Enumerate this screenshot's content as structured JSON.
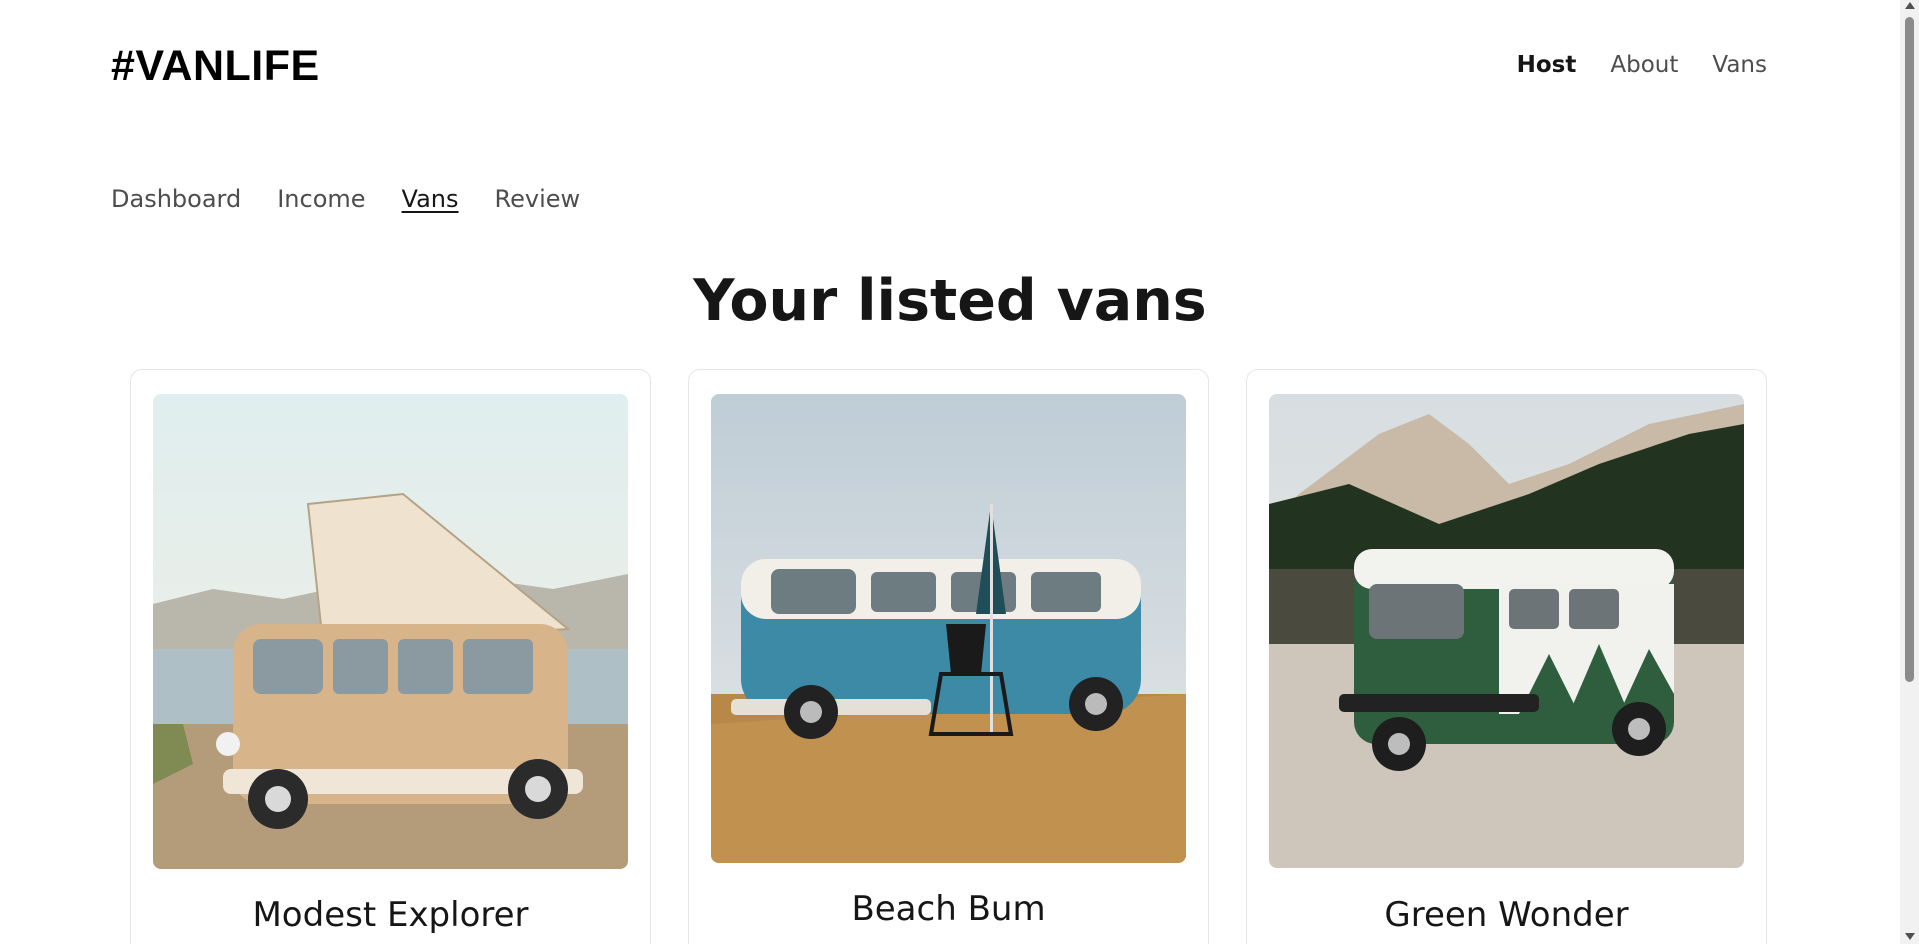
{
  "header": {
    "logo": "#VANLIFE",
    "nav": [
      {
        "label": "Host",
        "active": true
      },
      {
        "label": "About",
        "active": false
      },
      {
        "label": "Vans",
        "active": false
      }
    ]
  },
  "host_nav": [
    {
      "label": "Dashboard",
      "active": false
    },
    {
      "label": "Income",
      "active": false
    },
    {
      "label": "Vans",
      "active": true
    },
    {
      "label": "Review",
      "active": false
    }
  ],
  "page_title": "Your listed vans",
  "vans": [
    {
      "name": "Modest Explorer",
      "van_color": "#d8b48a"
    },
    {
      "name": "Beach Bum",
      "van_color": "#3c8aa6"
    },
    {
      "name": "Green Wonder",
      "van_color": "#2f5e3e"
    }
  ]
}
